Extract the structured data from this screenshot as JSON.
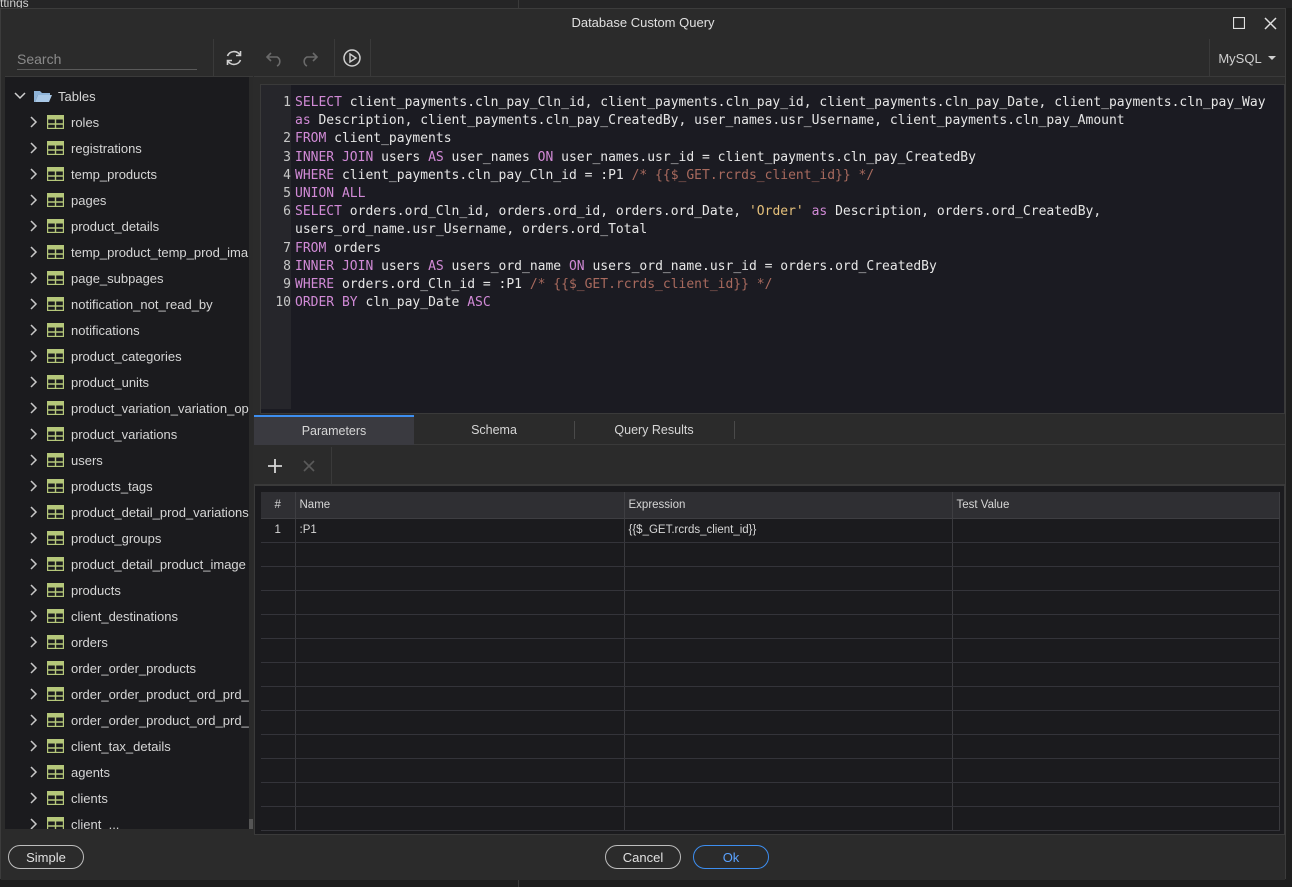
{
  "background": {
    "partial_text": "ttings"
  },
  "window": {
    "title": "Database Custom Query"
  },
  "search": {
    "placeholder": "Search"
  },
  "tree": {
    "root_label": "Tables",
    "items": [
      "roles",
      "registrations",
      "temp_products",
      "pages",
      "product_details",
      "temp_product_temp_prod_ima",
      "page_subpages",
      "notification_not_read_by",
      "notifications",
      "product_categories",
      "product_units",
      "product_variation_variation_op",
      "product_variations",
      "users",
      "products_tags",
      "product_detail_prod_variations",
      "product_groups",
      "product_detail_product_image",
      "products",
      "client_destinations",
      "orders",
      "order_order_products",
      "order_order_product_ord_prd_",
      "order_order_product_ord_prd_",
      "client_tax_details",
      "agents",
      "clients",
      "client_..."
    ]
  },
  "toolbar": {
    "dialect": "MySQL"
  },
  "editor": {
    "line_numbers": [
      "1",
      "2",
      "3",
      "4",
      "5",
      "6",
      "7",
      "8",
      "9",
      "10"
    ]
  },
  "tabs": [
    "Parameters",
    "Schema",
    "Query Results"
  ],
  "params": {
    "columns": [
      "#",
      "Name",
      "Expression",
      "Test Value"
    ],
    "rows": [
      {
        "num": "1",
        "name": ":P1",
        "expression": "{{$_GET.rcrds_client_id}}",
        "test_value": ""
      }
    ]
  },
  "footer": {
    "simple": "Simple",
    "cancel": "Cancel",
    "ok": "Ok"
  },
  "colors": {
    "accent": "#3d8ef0",
    "keyword": "#d18ad6",
    "comment": "#a86a5e",
    "string": "#e5c07b",
    "table_icon": "#b5c77a"
  }
}
